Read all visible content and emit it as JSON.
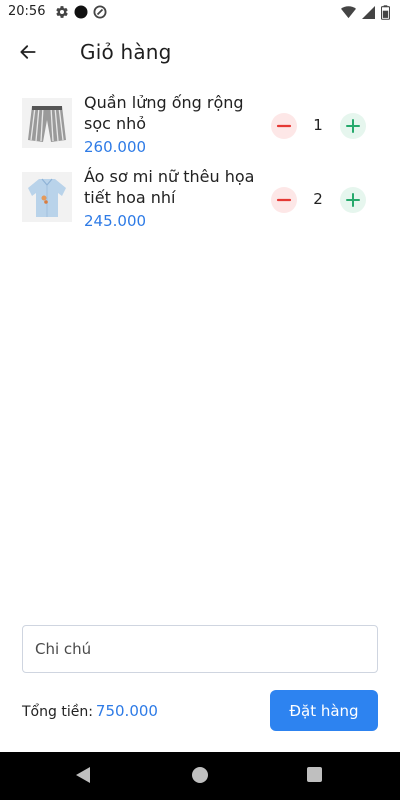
{
  "status_bar": {
    "time": "20:56",
    "icons": [
      "gear-icon",
      "dot-icon",
      "sync-icon",
      "wifi-icon",
      "signal-icon",
      "battery-icon"
    ]
  },
  "app_bar": {
    "title": "Giỏ hàng",
    "back_icon": "arrow-left-icon"
  },
  "cart": {
    "items": [
      {
        "name": "Quần lửng ống rộng sọc nhỏ",
        "price": "260.000",
        "quantity": "1",
        "image": "striped-shorts-image"
      },
      {
        "name": "Áo sơ mi nữ thêu họa tiết hoa nhí",
        "price": "245.000",
        "quantity": "2",
        "image": "embroidered-shirt-image"
      }
    ]
  },
  "note": {
    "placeholder": "Chi chú",
    "value": ""
  },
  "footer": {
    "total_label": "Tổng tiền:",
    "total_value": "750.000",
    "order_button_label": "Đặt hàng"
  },
  "colors": {
    "accent": "#2d83f0",
    "price": "#2e7be6",
    "minus": "#e53935",
    "plus": "#26a96c"
  }
}
